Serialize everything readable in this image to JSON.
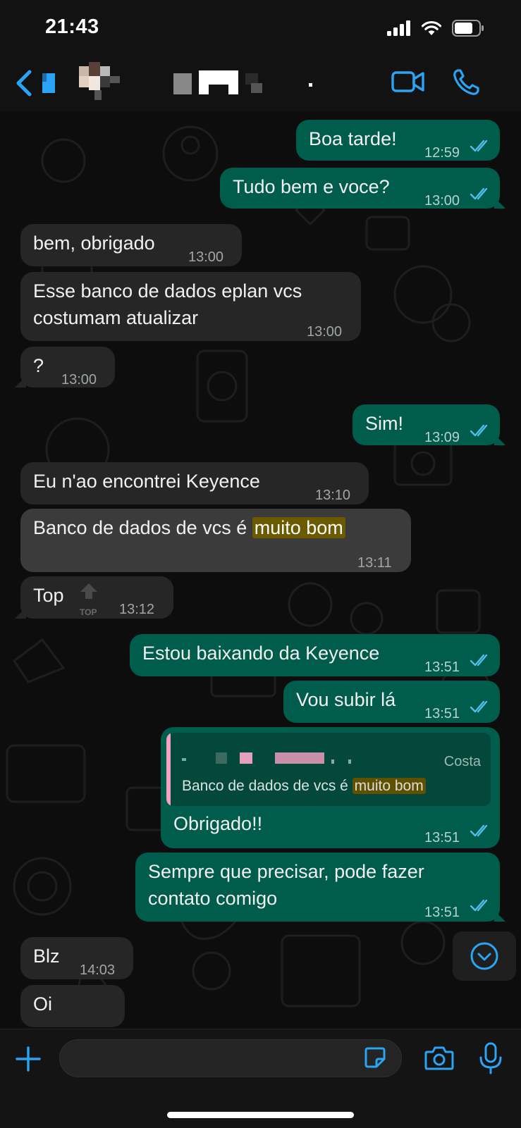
{
  "status_bar": {
    "time": "21:43",
    "battery_level": 0.75
  },
  "header": {
    "contact_name_redacted": true
  },
  "colors": {
    "accent": "#2aa4f4",
    "outgoing_bubble": "#005c4b",
    "incoming_bubble": "#262626",
    "highlight": "#6b5a00"
  },
  "messages": [
    {
      "dir": "out",
      "text": "Boa tarde!",
      "time": "12:59",
      "status": "read"
    },
    {
      "dir": "out",
      "text": "Tudo bem e voce?",
      "time": "13:00",
      "status": "read"
    },
    {
      "dir": "in",
      "text": "bem, obrigado",
      "time": "13:00"
    },
    {
      "dir": "in",
      "line1": "Esse banco de dados eplan vcs",
      "line2": "costumam atualizar",
      "time": "13:00"
    },
    {
      "dir": "in",
      "text": "?",
      "time": "13:00"
    },
    {
      "dir": "out",
      "text": "Sim!",
      "time": "13:09",
      "status": "read"
    },
    {
      "dir": "in",
      "text": "Eu n'ao encontrei Keyence",
      "time": "13:10"
    },
    {
      "dir": "in",
      "text_before": "Banco de dados de vcs é ",
      "highlight": "muito bom",
      "time": "13:11",
      "selected": true
    },
    {
      "dir": "in",
      "text": "Top",
      "reaction_label": "TOP",
      "time": "13:12"
    },
    {
      "dir": "out",
      "text": "Estou baixando da Keyence",
      "time": "13:51",
      "status": "read"
    },
    {
      "dir": "out",
      "text": "Vou subir lá",
      "time": "13:51",
      "status": "read"
    },
    {
      "dir": "out",
      "quote_author": "Costa",
      "quote_before": "Banco de dados de vcs é ",
      "quote_highlight": "muito bom",
      "text": "Obrigado!!",
      "time": "13:51",
      "status": "read"
    },
    {
      "dir": "out",
      "line1": "Sempre que precisar, pode fazer",
      "line2": "contato comigo",
      "time": "13:51",
      "status": "read"
    },
    {
      "dir": "in",
      "text": "Blz",
      "time": "14:03"
    },
    {
      "dir": "in",
      "text": "Oi",
      "time": ""
    }
  ],
  "input": {
    "placeholder": ""
  }
}
